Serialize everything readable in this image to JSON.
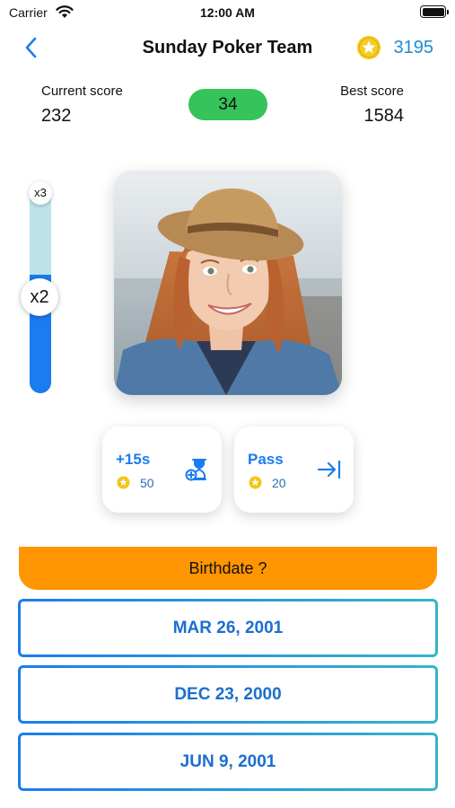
{
  "status_bar": {
    "carrier": "Carrier",
    "time": "12:00 AM"
  },
  "nav": {
    "title": "Sunday Poker Team",
    "coins": "3195",
    "back_icon": "chevron-left-icon",
    "coin_icon": "star-coin-icon"
  },
  "scores": {
    "current_label": "Current score",
    "current_value": "232",
    "best_label": "Best score",
    "best_value": "1584",
    "round_score": "34"
  },
  "multiplier": {
    "top_label": "x3",
    "current_label": "x2",
    "level": 0.57
  },
  "powerups": [
    {
      "label": "+15s",
      "cost": "50",
      "icon": "hourglass-add-icon"
    },
    {
      "label": "Pass",
      "cost": "20",
      "icon": "skip-arrow-icon"
    }
  ],
  "question": {
    "text": "Birthdate ?"
  },
  "answers": [
    {
      "label": "MAR 26, 2001"
    },
    {
      "label": "DEC 23, 2000"
    },
    {
      "label": "JUN 9, 2001"
    }
  ],
  "colors": {
    "accent_blue": "#1a7cf0",
    "coin_yellow": "#f5c518",
    "score_green": "#35c35a",
    "question_orange": "#ff9500",
    "answer_teal": "#35b4c8"
  }
}
